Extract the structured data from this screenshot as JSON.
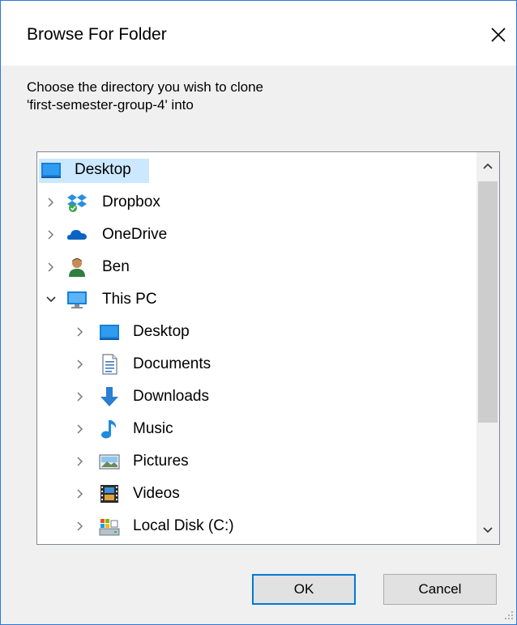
{
  "window": {
    "title": "Browse For Folder",
    "close_label": "×"
  },
  "prompt": {
    "line1": "Choose the directory you wish to clone",
    "line2": "'first-semester-group-4' into"
  },
  "tree": {
    "items": [
      {
        "label": "Desktop",
        "icon": "desktop-icon",
        "selected": true
      },
      {
        "label": "Dropbox",
        "icon": "dropbox-icon"
      },
      {
        "label": "OneDrive",
        "icon": "onedrive-icon"
      },
      {
        "label": "Ben",
        "icon": "user-icon"
      },
      {
        "label": "This PC",
        "icon": "computer-icon",
        "expanded": true
      },
      {
        "label": "Desktop",
        "icon": "desktop-icon"
      },
      {
        "label": "Documents",
        "icon": "documents-icon"
      },
      {
        "label": "Downloads",
        "icon": "downloads-icon"
      },
      {
        "label": "Music",
        "icon": "music-icon"
      },
      {
        "label": "Pictures",
        "icon": "pictures-icon"
      },
      {
        "label": "Videos",
        "icon": "videos-icon"
      },
      {
        "label": "Local Disk (C:)",
        "icon": "local-disk-icon"
      }
    ]
  },
  "buttons": {
    "ok": "OK",
    "cancel": "Cancel"
  },
  "colors": {
    "accent": "#0078d7",
    "selection": "#cce8ff",
    "window_border": "#2b79d9"
  }
}
